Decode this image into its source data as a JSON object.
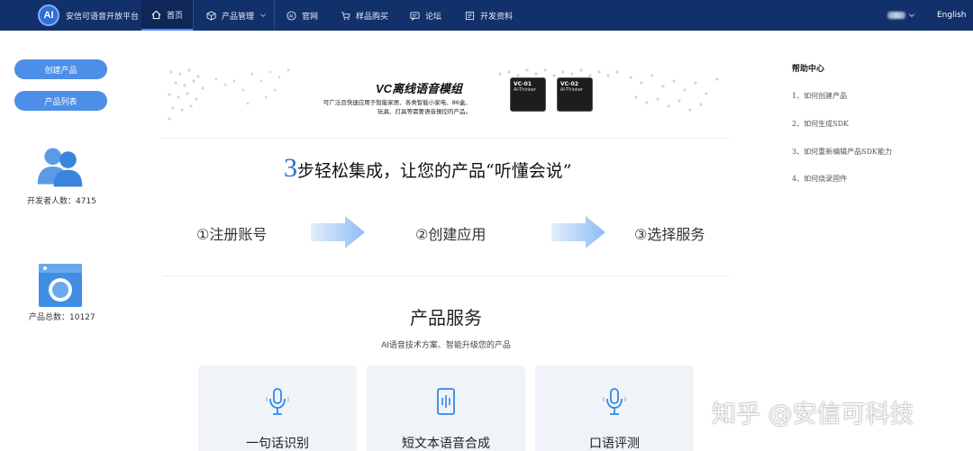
{
  "nav": {
    "logo_text": "AI",
    "brand": "安信可语音开放平台",
    "items": [
      {
        "label": "首页",
        "icon": "home-icon"
      },
      {
        "label": "产品管理",
        "icon": "box-icon"
      },
      {
        "label": "官网",
        "icon": "ai-icon"
      },
      {
        "label": "样品购买",
        "icon": "cart-icon"
      },
      {
        "label": "论坛",
        "icon": "chat-icon"
      },
      {
        "label": "开发资料",
        "icon": "doc-icon"
      }
    ],
    "language": "English"
  },
  "sidebar": {
    "create_product": "创建产品",
    "product_list": "产品列表",
    "developer_count_label": "开发者人数：4715",
    "product_total_label": "产品总数：10127"
  },
  "banner": {
    "title": "VC离线语音模组",
    "desc_line1": "可广泛且快速应用于智能家居、各类智能小家电、86盒、",
    "desc_line2": "玩具、灯具等需要语音操控的产品。",
    "chip1": "VC-01",
    "chip2": "VC-02",
    "chip_sub": "AI-Thinker"
  },
  "steps": {
    "number": "3",
    "title_rest": "步轻松集成，让您的产品“听懂会说”",
    "step1": "①注册账号",
    "step2": "②创建应用",
    "step3": "③选择服务"
  },
  "services": {
    "title": "产品服务",
    "subtitle": "AI语音技术方案、智能升级您的产品",
    "cards": [
      {
        "label": "一句话识别",
        "icon": "microphone-icon"
      },
      {
        "label": "短文本语音合成",
        "icon": "phone-sound-icon"
      },
      {
        "label": "口语评测",
        "icon": "microphone-icon"
      }
    ]
  },
  "help": {
    "title": "帮助中心",
    "links": [
      "1、如何创建产品",
      "2、如何生成SDK",
      "3、如何重新编辑产品SDK能力",
      "4、如何烧录固件"
    ]
  },
  "watermark": "知乎 @安信可科技",
  "colors": {
    "nav_bg": "#12306a",
    "accent": "#4d8fe6",
    "step_blue": "#2a6fd1",
    "card_bg": "#f0f3f8"
  }
}
